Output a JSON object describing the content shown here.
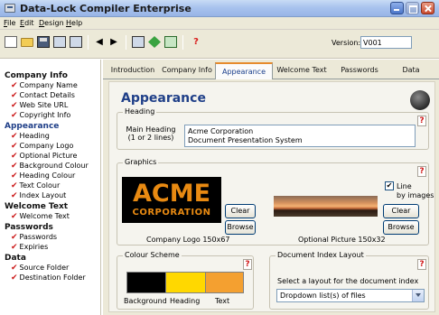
{
  "window": {
    "title": "Data-Lock Compiler Enterprise"
  },
  "menu": [
    "File",
    "Edit",
    "Design",
    "Help"
  ],
  "toolbar": {
    "version_label": "Version:",
    "version_value": "V001"
  },
  "sidebar": {
    "groups": [
      {
        "label": "Company Info",
        "items": [
          "Company Name",
          "Contact Details",
          "Web Site URL",
          "Copyright Info"
        ]
      },
      {
        "label": "Appearance",
        "items": [
          "Heading",
          "Company Logo",
          "Optional Picture",
          "Background Colour",
          "Heading Colour",
          "Text Colour",
          "Index Layout"
        ]
      },
      {
        "label": "Welcome Text",
        "items": [
          "Welcome Text"
        ]
      },
      {
        "label": "Passwords",
        "items": [
          "Passwords",
          "Expiries"
        ]
      },
      {
        "label": "Data",
        "items": [
          "Source Folder",
          "Destination Folder"
        ]
      }
    ],
    "check_glyph": "✔"
  },
  "tabs": [
    "Introduction",
    "Company Info",
    "Appearance",
    "Welcome Text",
    "Passwords",
    "Data"
  ],
  "active_tab": "Appearance",
  "page": {
    "title": "Appearance",
    "heading": {
      "group_label": "Heading",
      "field_label": "Main Heading\n(1 or 2 lines)",
      "value": "Acme Corporation\nDocument Presentation System"
    },
    "graphics": {
      "group_label": "Graphics",
      "logo": {
        "text_line1": "ACME",
        "text_line2": "CORPORATION",
        "caption": "Company Logo  150x67",
        "clear_label": "Clear",
        "browse_label": "Browse"
      },
      "picture": {
        "caption": "Optional Picture  150x32",
        "clear_label": "Clear",
        "browse_label": "Browse",
        "line_checkbox_label": "Line\nby images",
        "line_checked": true
      }
    },
    "colour_scheme": {
      "group_label": "Colour Scheme",
      "swatches": [
        {
          "label": "Background",
          "color": "#000000"
        },
        {
          "label": "Heading",
          "color": "#ffd800"
        },
        {
          "label": "Text",
          "color": "#f4a030"
        }
      ]
    },
    "index_layout": {
      "group_label": "Document Index Layout",
      "prompt": "Select a layout for the document index",
      "selected": "Dropdown list(s) of files"
    },
    "help_glyph": "?"
  },
  "colors": {
    "accent": "#1f3f88",
    "check": "#cc1a1a",
    "logo_orange": "#e88a12"
  }
}
